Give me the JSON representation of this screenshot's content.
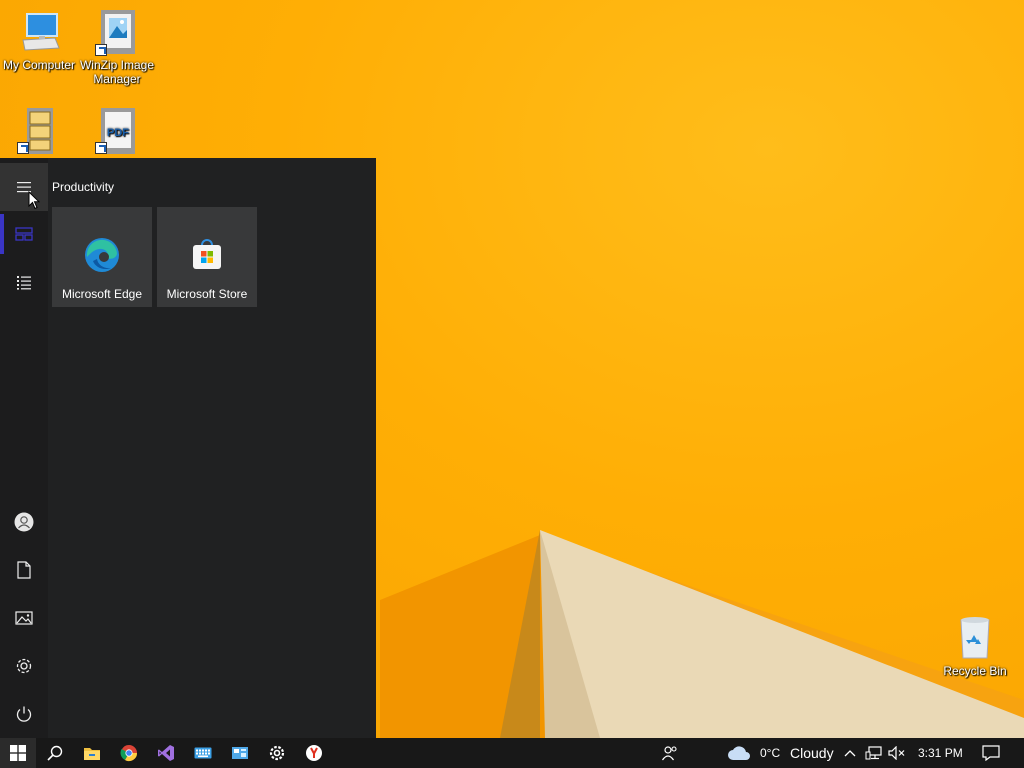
{
  "desktop": {
    "icons": [
      {
        "label": "My Computer",
        "icon": "computer-icon"
      },
      {
        "label": "WinZip Image Manager",
        "icon": "winzip-image-icon"
      },
      {
        "label": "",
        "icon": "winzip-icon"
      },
      {
        "label": "",
        "icon": "pdf-icon"
      }
    ],
    "recycle_bin": {
      "label": "Recycle Bin",
      "icon": "recycle-bin-icon"
    }
  },
  "start_menu": {
    "group_title": "Productivity",
    "tiles": [
      {
        "label": "Microsoft Edge",
        "icon": "edge-icon"
      },
      {
        "label": "Microsoft Store",
        "icon": "store-icon"
      }
    ],
    "rail_items": [
      "menu-icon",
      "all-tiles-icon",
      "app-list-icon",
      "user-icon",
      "documents-icon",
      "pictures-icon",
      "settings-icon",
      "power-icon"
    ]
  },
  "taskbar": {
    "apps": [
      "start-icon",
      "search-icon",
      "file-explorer-icon",
      "chrome-icon",
      "visual-studio-icon",
      "keyboard-icon",
      "control-panel-icon",
      "settings-icon",
      "yandex-icon"
    ],
    "weather": {
      "temp": "0°C",
      "condition": "Cloudy"
    },
    "clock": "3:31 PM",
    "accent": "#3a35c5"
  }
}
